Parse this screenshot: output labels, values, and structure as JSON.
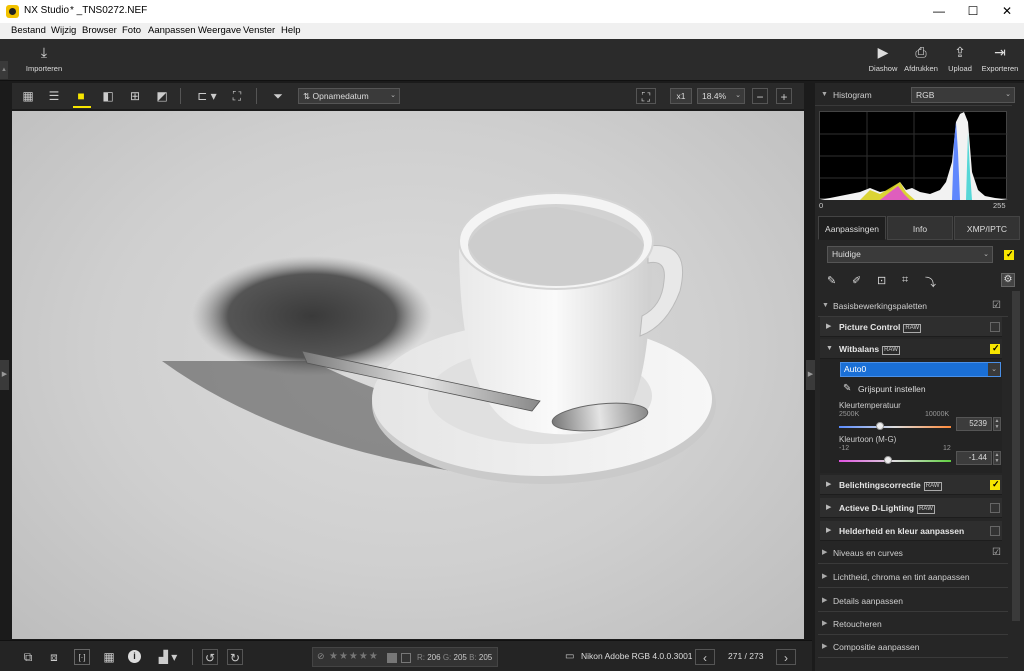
{
  "titlebar": {
    "app_title": "NX Studio",
    "file_name": "* _TNS0272.NEF"
  },
  "menu": [
    "Bestand",
    "Wijzig",
    "Browser",
    "Foto",
    "Aanpassen",
    "Weergave",
    "Venster",
    "Help"
  ],
  "toolbar": {
    "import_label": "Importeren",
    "slideshow_label": "Diashow",
    "print_label": "Afdrukken",
    "upload_label": "Upload",
    "export_label": "Exporteren"
  },
  "viewbar": {
    "sort_label": "Opnamedatum",
    "zoom_multiplier": "x1",
    "zoom_level": "18.4%"
  },
  "histogram": {
    "title": "Histogram",
    "channel": "RGB",
    "min_label": "0",
    "max_label": "255"
  },
  "tabs": [
    "Aanpassingen",
    "Info",
    "XMP/IPTC"
  ],
  "adjust": {
    "preset": "Huidige",
    "basic_palettes": "Basisbewerkingspaletten",
    "picture_control": "Picture Control",
    "white_balance": "Witbalans",
    "wb_mode": "Auto0",
    "grey_point": "Grijspunt instellen",
    "temp_label": "Kleurtemperatuur",
    "temp_min": "2500K",
    "temp_max": "10000K",
    "temp_value": "5239",
    "tint_label": "Kleurtoon (M-G)",
    "tint_min": "-12",
    "tint_max": "12",
    "tint_value": "-1.44",
    "exposure": "Belichtingscorrectie",
    "adl": "Actieve D-Lighting",
    "brightness": "Helderheid en kleur aanpassen",
    "raw_badge": "RAW",
    "sections": [
      "Niveaus en curves",
      "Lichtheid, chroma en tint aanpassen",
      "Details aanpassen",
      "Retoucheren",
      "Compositie aanpassen"
    ]
  },
  "bottombar": {
    "r_label": "R:",
    "r_value": "206",
    "g_label": "G:",
    "g_value": "205",
    "b_label": "B:",
    "b_value": "205",
    "color_profile": "Nikon Adobe RGB 4.0.0.3001",
    "page_indicator": "271 / 273"
  },
  "colors": {
    "accent": "#f7e500",
    "selection": "#1a6fd6"
  }
}
